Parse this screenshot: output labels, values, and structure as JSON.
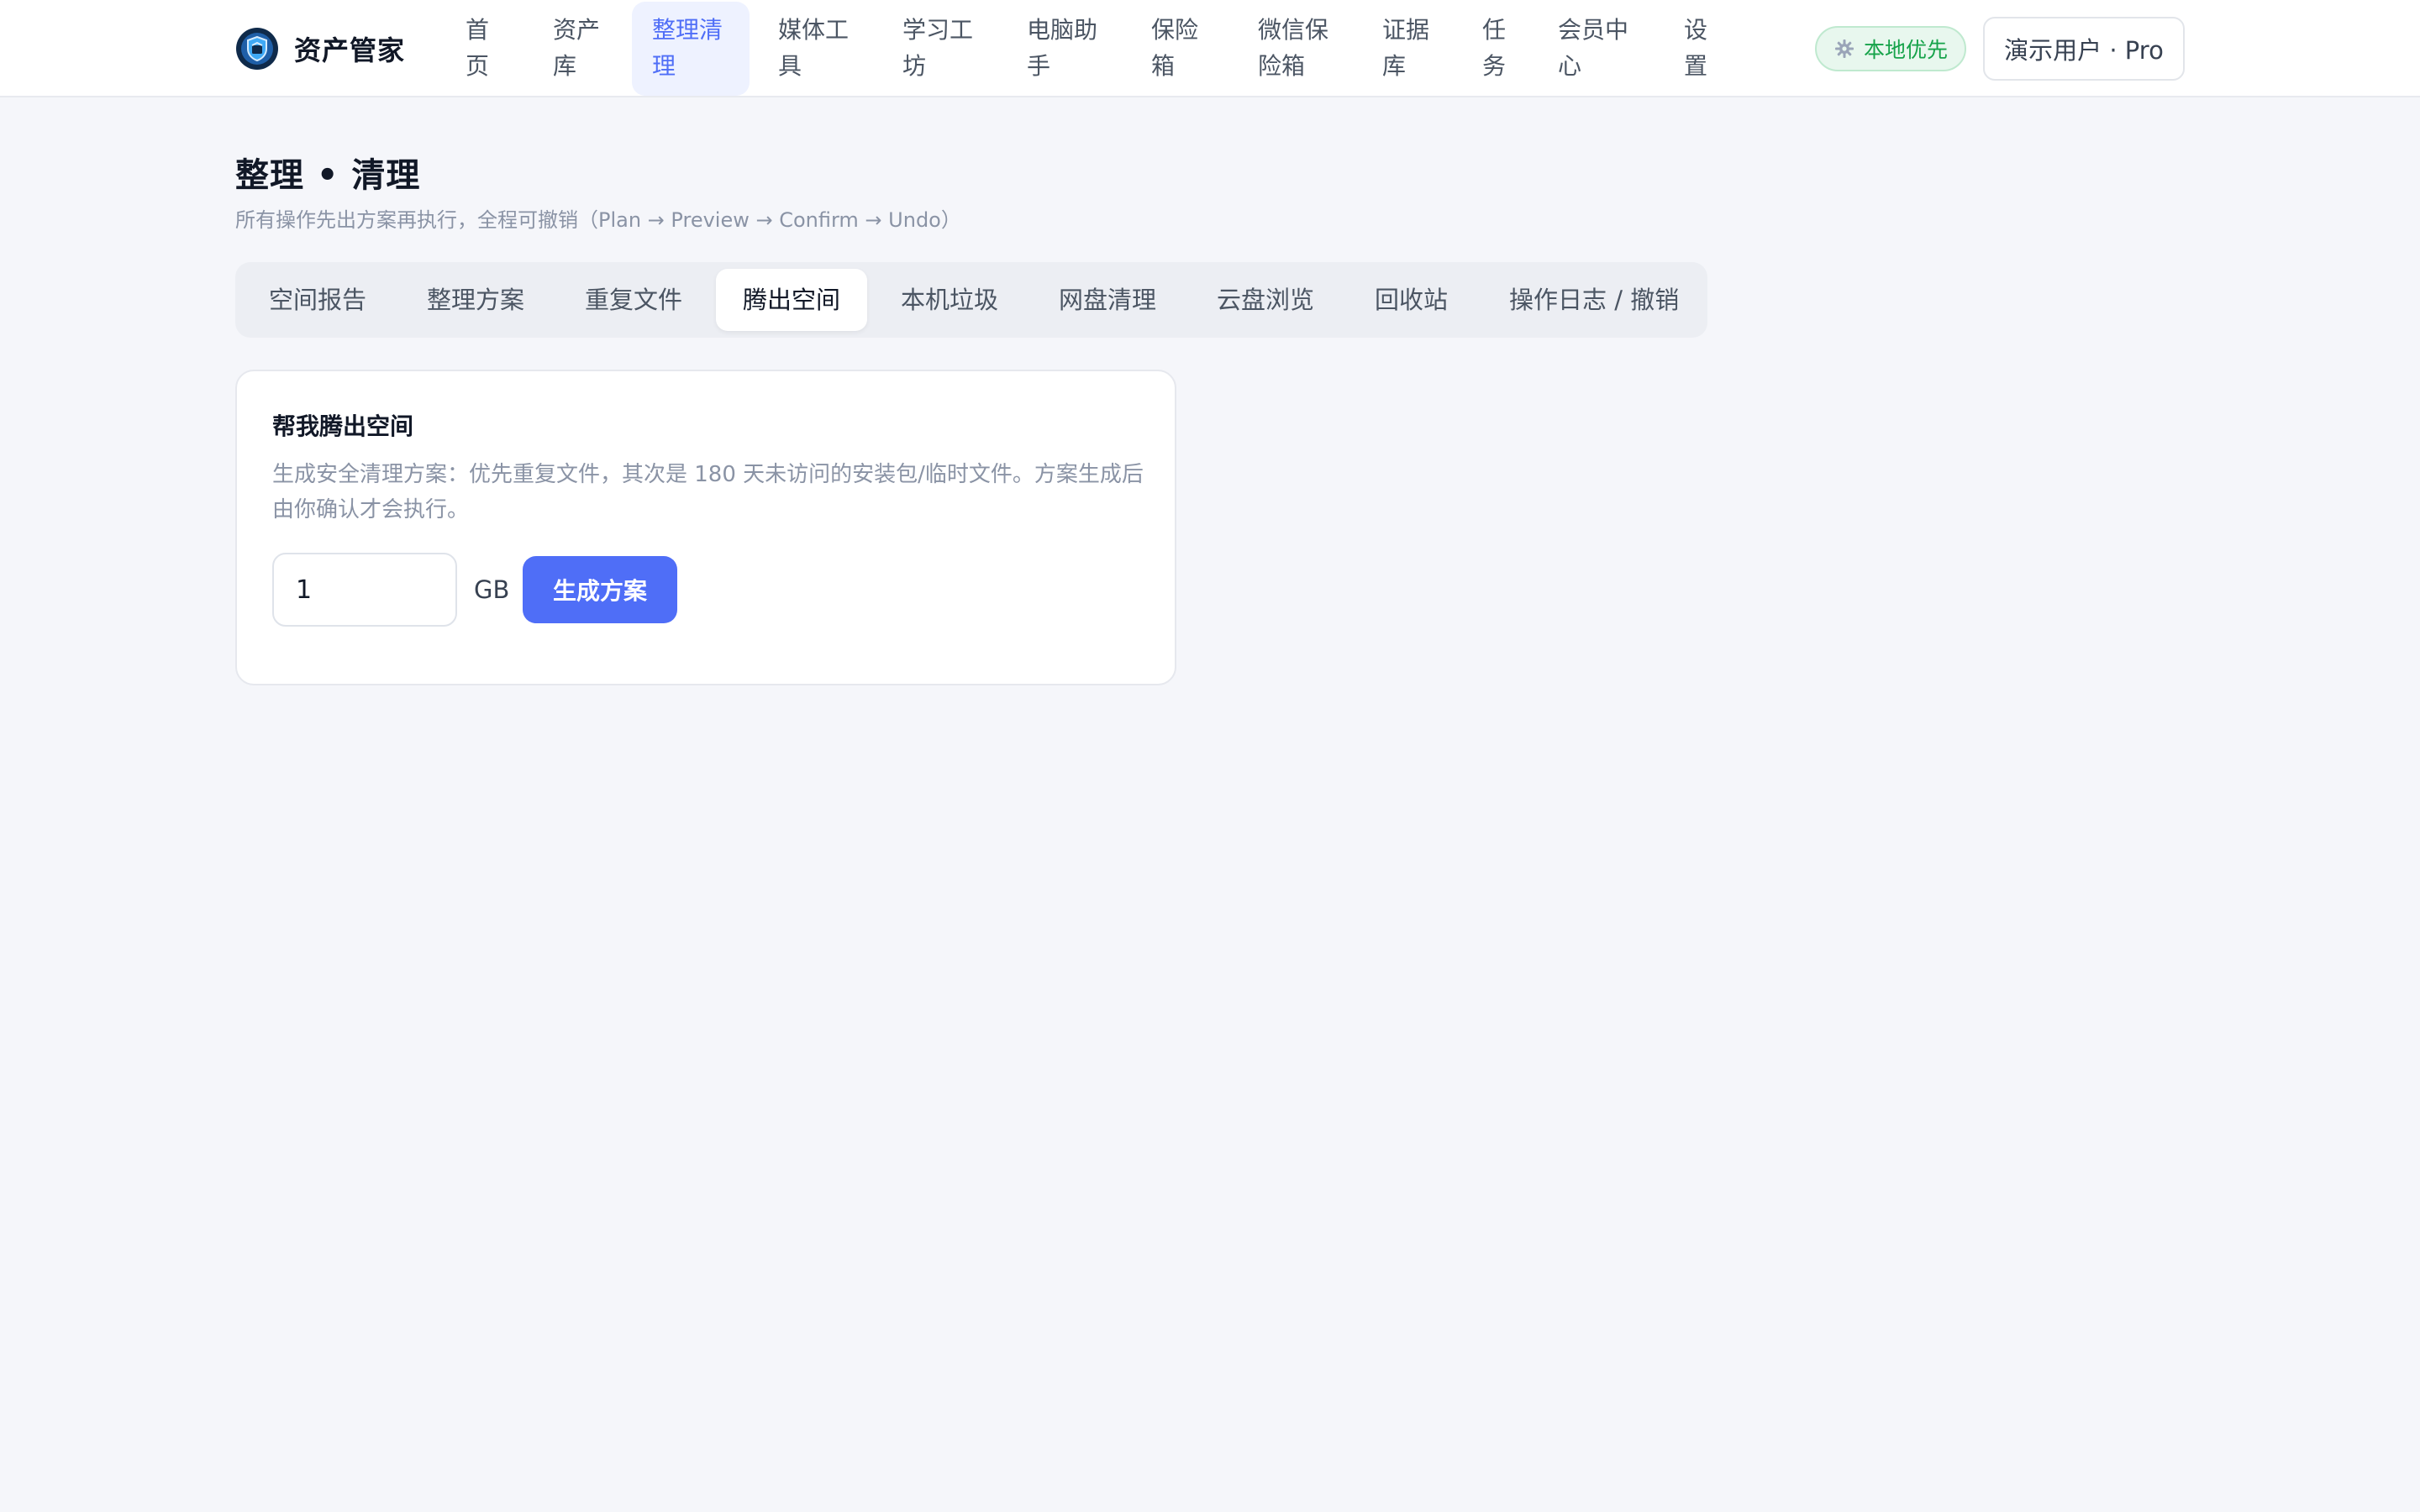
{
  "brand": {
    "name": "资产管家",
    "logo_icon": "shield-box-icon"
  },
  "nav": {
    "items": [
      {
        "label": "首页",
        "active": false
      },
      {
        "label": "资产库",
        "active": false
      },
      {
        "label": "整理清理",
        "active": true
      },
      {
        "label": "媒体工具",
        "active": false
      },
      {
        "label": "学习工坊",
        "active": false
      },
      {
        "label": "电脑助手",
        "active": false
      },
      {
        "label": "保险箱",
        "active": false
      },
      {
        "label": "微信保险箱",
        "active": false
      },
      {
        "label": "证据库",
        "active": false
      },
      {
        "label": "任务",
        "active": false
      },
      {
        "label": "会员中心",
        "active": false
      },
      {
        "label": "设置",
        "active": false
      }
    ]
  },
  "header": {
    "local_badge": "本地优先",
    "user_label": "演示用户 · Pro"
  },
  "page": {
    "title": "整理 • 清理",
    "subtitle": "所有操作先出方案再执行，全程可撤销（Plan → Preview → Confirm → Undo）"
  },
  "tabs": [
    {
      "label": "空间报告",
      "active": false
    },
    {
      "label": "整理方案",
      "active": false
    },
    {
      "label": "重复文件",
      "active": false
    },
    {
      "label": "腾出空间",
      "active": true
    },
    {
      "label": "本机垃圾",
      "active": false
    },
    {
      "label": "网盘清理",
      "active": false
    },
    {
      "label": "云盘浏览",
      "active": false
    },
    {
      "label": "回收站",
      "active": false
    },
    {
      "label": "操作日志 / 撤销",
      "active": false
    }
  ],
  "free_space": {
    "title": "帮我腾出空间",
    "description": "生成安全清理方案：优先重复文件，其次是 180 天未访问的安装包/临时文件。方案生成后由你确认才会执行。",
    "amount_value": "1",
    "unit": "GB",
    "generate_label": "生成方案"
  },
  "colors": {
    "accent": "#4f6ef7",
    "active_nav_bg": "#eef2ff",
    "badge_green": "#16a34a",
    "page_bg": "#f5f6fa"
  }
}
